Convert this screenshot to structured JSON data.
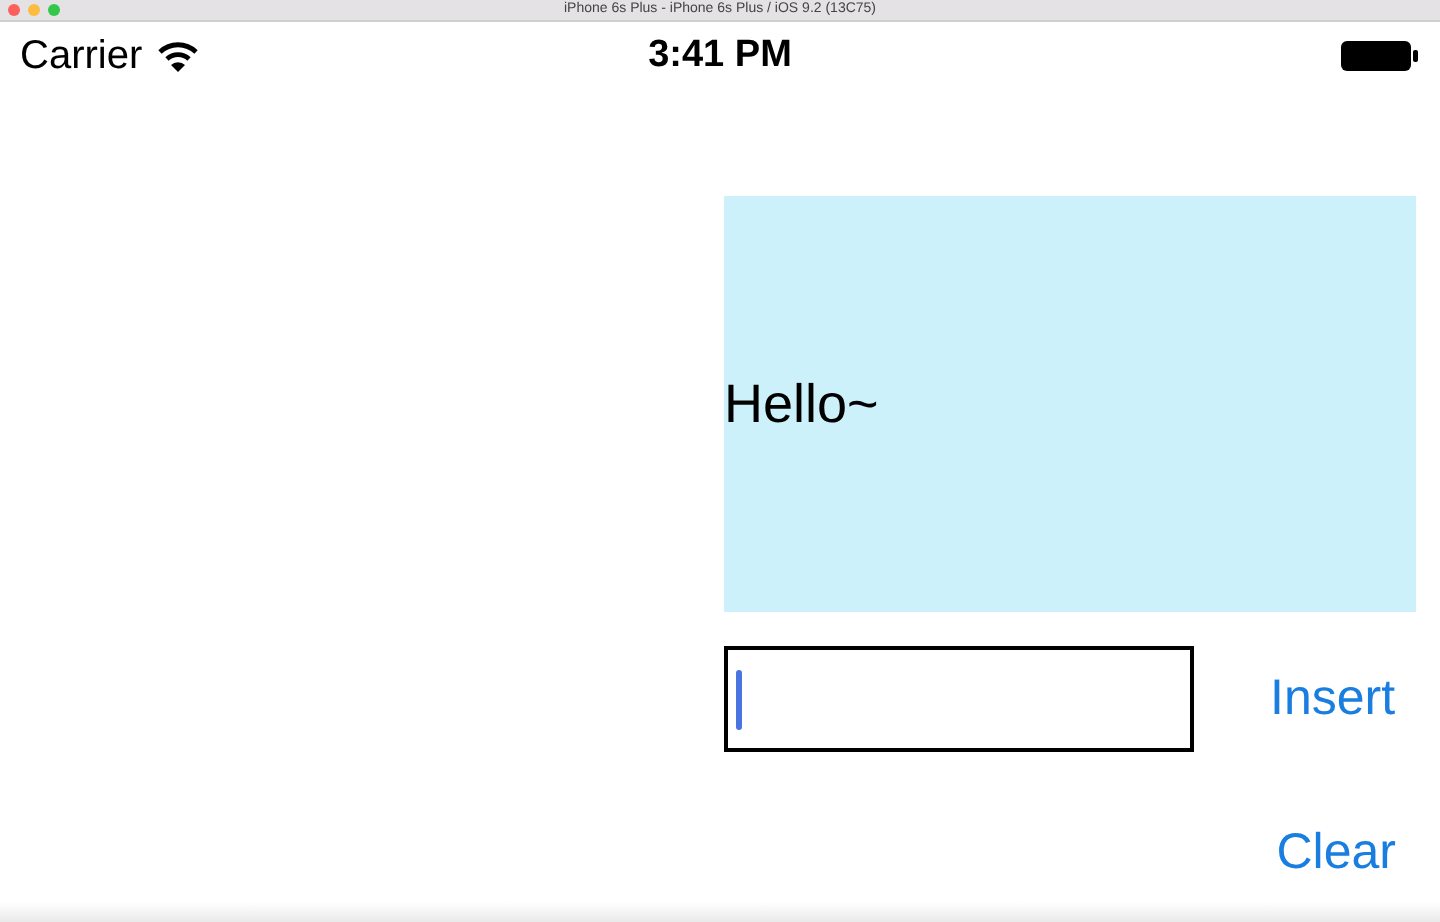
{
  "window": {
    "title": "iPhone 6s Plus - iPhone 6s Plus / iOS 9.2 (13C75)"
  },
  "status_bar": {
    "carrier": "Carrier",
    "time": "3:41 PM"
  },
  "label": {
    "text": "Hello~"
  },
  "text_field": {
    "focused": true
  },
  "buttons": [
    {
      "label": "Insert"
    },
    {
      "label": "Clear"
    }
  ]
}
